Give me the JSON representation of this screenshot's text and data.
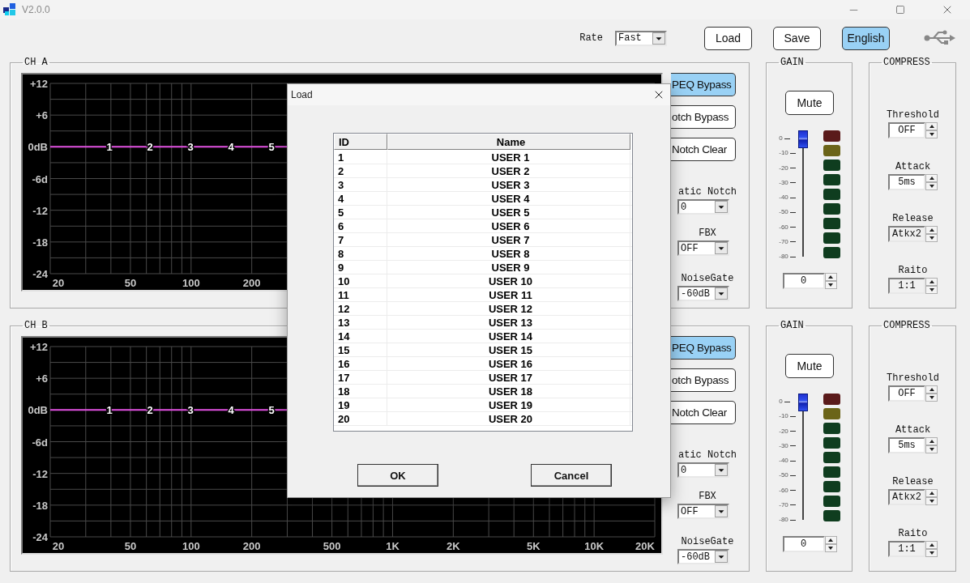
{
  "window": {
    "title": "V2.0.0"
  },
  "toolbar": {
    "rate": {
      "label": "Rate",
      "value": "Fast"
    },
    "buttons": [
      {
        "label": "Load",
        "selected": false
      },
      {
        "label": "Save",
        "selected": false
      },
      {
        "label": "English",
        "selected": true
      }
    ]
  },
  "channels": [
    {
      "title": "CH A",
      "graph": {
        "y_labels": [
          "+12",
          "+6",
          "0dB",
          "-6d",
          "-12",
          "-18",
          "-24"
        ],
        "x_labels": [
          "20",
          "50",
          "100",
          "200"
        ],
        "points": [
          "1",
          "2",
          "3",
          "4",
          "5"
        ]
      },
      "buttons": [
        {
          "label": "PEQ Bypass",
          "selected": true
        },
        {
          "label": "otch Bypass",
          "selected": false
        },
        {
          "label": "Notch Clear",
          "selected": false
        }
      ],
      "selects": [
        {
          "label": "atic Notch",
          "value": "0"
        },
        {
          "label": "FBX",
          "value": "OFF"
        },
        {
          "label": "NoiseGate",
          "value": "-60dB"
        }
      ],
      "gain": {
        "title": "GAIN",
        "mute": "Mute",
        "scale": [
          "0",
          "-10",
          "-20",
          "-30",
          "-40",
          "-50",
          "-60",
          "-70",
          "-80"
        ],
        "fader": {
          "level": 1
        },
        "leds": [
          {
            "color": "#5a1a1a"
          },
          {
            "color": "#6b6418"
          },
          {
            "color": "#0f3d1f"
          },
          {
            "color": "#0f3d1f"
          },
          {
            "color": "#0f3d1f"
          },
          {
            "color": "#0f3d1f"
          },
          {
            "color": "#0f3d1f"
          },
          {
            "color": "#0f3d1f"
          },
          {
            "color": "#0f3d1f"
          }
        ],
        "value": "0"
      },
      "compress": {
        "title": "COMPRESS",
        "fields": [
          {
            "label": "Threshold",
            "value": "OFF",
            "disabled": false
          },
          {
            "label": "Attack",
            "value": "5ms",
            "disabled": false
          },
          {
            "label": "Release",
            "value": "Atkx2",
            "disabled": true
          },
          {
            "label": "Raito",
            "value": "1:1",
            "disabled": true
          }
        ]
      }
    },
    {
      "title": "CH B",
      "graph": {
        "y_labels": [
          "+12",
          "+6",
          "0dB",
          "-6d",
          "-12",
          "-18",
          "-24"
        ],
        "x_labels": [
          "20",
          "50",
          "100",
          "200",
          "500",
          "1K",
          "2K",
          "5K",
          "10K",
          "20K"
        ],
        "points": [
          "1",
          "2",
          "3",
          "4",
          "5"
        ]
      },
      "buttons": [
        {
          "label": "PEQ Bypass",
          "selected": true
        },
        {
          "label": "otch Bypass",
          "selected": false
        },
        {
          "label": "Notch Clear",
          "selected": false
        }
      ],
      "selects": [
        {
          "label": "atic Notch",
          "value": "0"
        },
        {
          "label": "FBX",
          "value": "OFF"
        },
        {
          "label": "NoiseGate",
          "value": "-60dB"
        }
      ],
      "gain": {
        "title": "GAIN",
        "mute": "Mute",
        "scale": [
          "0",
          "-10",
          "-20",
          "-30",
          "-40",
          "-50",
          "-60",
          "-70",
          "-80"
        ],
        "fader": {
          "level": 1
        },
        "leds": [
          {
            "color": "#5a1a1a"
          },
          {
            "color": "#6b6418"
          },
          {
            "color": "#0f3d1f"
          },
          {
            "color": "#0f3d1f"
          },
          {
            "color": "#0f3d1f"
          },
          {
            "color": "#0f3d1f"
          },
          {
            "color": "#0f3d1f"
          },
          {
            "color": "#0f3d1f"
          },
          {
            "color": "#0f3d1f"
          }
        ],
        "value": "0"
      },
      "compress": {
        "title": "COMPRESS",
        "fields": [
          {
            "label": "Threshold",
            "value": "OFF",
            "disabled": false
          },
          {
            "label": "Attack",
            "value": "5ms",
            "disabled": false
          },
          {
            "label": "Release",
            "value": "Atkx2",
            "disabled": true
          },
          {
            "label": "Raito",
            "value": "1:1",
            "disabled": true
          }
        ]
      }
    }
  ],
  "dialog": {
    "title": "Load",
    "columns": [
      "ID",
      "Name"
    ],
    "rows": [
      {
        "id": "1",
        "name": "USER 1"
      },
      {
        "id": "2",
        "name": "USER 2"
      },
      {
        "id": "3",
        "name": "USER 3"
      },
      {
        "id": "4",
        "name": "USER 4"
      },
      {
        "id": "5",
        "name": "USER 5"
      },
      {
        "id": "6",
        "name": "USER 6"
      },
      {
        "id": "7",
        "name": "USER 7"
      },
      {
        "id": "8",
        "name": "USER 8"
      },
      {
        "id": "9",
        "name": "USER 9"
      },
      {
        "id": "10",
        "name": "USER 10"
      },
      {
        "id": "11",
        "name": "USER 11"
      },
      {
        "id": "12",
        "name": "USER 12"
      },
      {
        "id": "13",
        "name": "USER 13"
      },
      {
        "id": "14",
        "name": "USER 14"
      },
      {
        "id": "15",
        "name": "USER 15"
      },
      {
        "id": "16",
        "name": "USER 16"
      },
      {
        "id": "17",
        "name": "USER 17"
      },
      {
        "id": "18",
        "name": "USER 18"
      },
      {
        "id": "19",
        "name": "USER 19"
      },
      {
        "id": "20",
        "name": "USER 20"
      }
    ],
    "buttons": [
      "OK",
      "Cancel"
    ]
  }
}
